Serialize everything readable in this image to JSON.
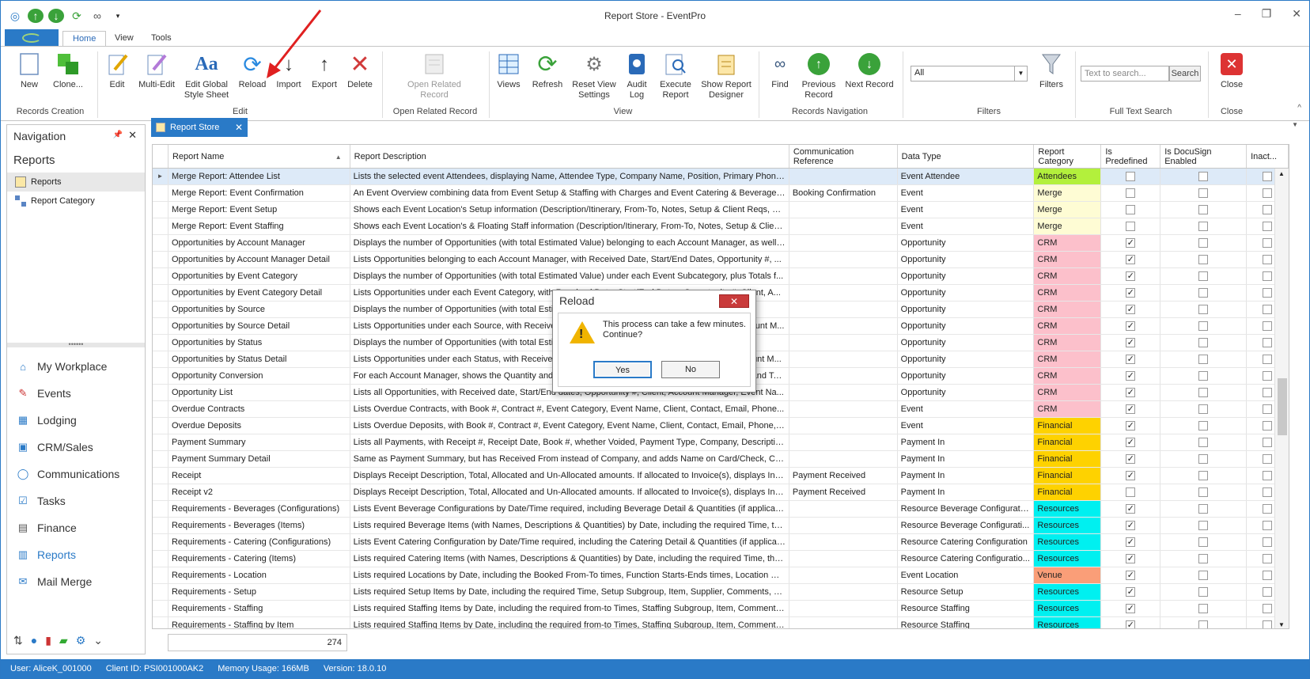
{
  "window": {
    "title": "Report Store - EventPro"
  },
  "menu_tabs": [
    "Home",
    "View",
    "Tools"
  ],
  "ribbon": {
    "buttons": {
      "new": "New",
      "clone": "Clone...",
      "edit": "Edit",
      "multi_edit": "Multi-Edit",
      "edit_global": "Edit Global Style Sheet",
      "reload": "Reload",
      "import": "Import",
      "export": "Export",
      "delete": "Delete",
      "open_related": "Open Related Record",
      "views": "Views",
      "refresh": "Refresh",
      "reset_view": "Reset View Settings",
      "audit_log": "Audit Log",
      "execute_report": "Execute Report",
      "show_designer": "Show Report Designer",
      "find": "Find",
      "previous_record": "Previous Record",
      "next_record": "Next Record",
      "filters": "Filters",
      "close": "Close",
      "search_button": "Search"
    },
    "groups": {
      "records_creation": "Records Creation",
      "edit": "Edit",
      "open_related": "Open Related Record",
      "view": "View",
      "records_navigation": "Records Navigation",
      "filters": "Filters",
      "full_text_search": "Full Text Search",
      "close": "Close"
    },
    "filter_select": "All",
    "search_placeholder": "Text to search..."
  },
  "navigation": {
    "title": "Navigation",
    "section": "Reports",
    "items": [
      "Reports",
      "Report Category"
    ],
    "modules": [
      "My Workplace",
      "Events",
      "Lodging",
      "CRM/Sales",
      "Communications",
      "Tasks",
      "Finance",
      "Reports",
      "Mail Merge"
    ]
  },
  "doc_tab": "Report Store",
  "grid": {
    "headers": [
      "Report Name",
      "Report Description",
      "Communication Reference",
      "Data Type",
      "Report Category",
      "Is Predefined",
      "Is DocuSign Enabled",
      "Inact..."
    ],
    "rows": [
      {
        "name": "Merge Report: Attendee List",
        "desc": "Lists the selected event Attendees, displaying Name, Attendee Type, Company Name, Position, Primary Phone,...",
        "comm": "",
        "type": "Event Attendee",
        "cat": "Attendees",
        "color": "#b3f03c",
        "pre": false
      },
      {
        "name": "Merge Report: Event Confirmation",
        "desc": "An Event Overview combining data from Event Setup & Staffing with Charges and Event Catering & Beverage ...",
        "comm": "Booking Confirmation",
        "type": "Event",
        "cat": "Merge",
        "color": "#fefcd4",
        "pre": false
      },
      {
        "name": "Merge Report: Event Setup",
        "desc": "Shows each Event Location's Setup information (Description/Itinerary, From-To, Notes, Setup & Client Reqs, Q...",
        "comm": "",
        "type": "Event",
        "cat": "Merge",
        "color": "#fefcd4",
        "pre": false
      },
      {
        "name": "Merge Report: Event Staffing",
        "desc": "Shows each Event Location's & Floating Staff information (Description/Itinerary, From-To, Notes, Setup & Client...",
        "comm": "",
        "type": "Event",
        "cat": "Merge",
        "color": "#fefcd4",
        "pre": false
      },
      {
        "name": "Opportunities by Account Manager",
        "desc": "Displays the number of Opportunities (with total Estimated Value) belonging to each Account Manager, as well a...",
        "comm": "",
        "type": "Opportunity",
        "cat": "CRM",
        "color": "#fcc0cb",
        "pre": true
      },
      {
        "name": "Opportunities by Account Manager Detail",
        "desc": "Lists Opportunities belonging to each Account Manager, with Received Date, Start/End Dates, Opportunity #, ...",
        "comm": "",
        "type": "Opportunity",
        "cat": "CRM",
        "color": "#fcc0cb",
        "pre": true
      },
      {
        "name": "Opportunities by Event Category",
        "desc": "Displays the number of Opportunities (with total Estimated Value) under each Event Subcategory, plus Totals f...",
        "comm": "",
        "type": "Opportunity",
        "cat": "CRM",
        "color": "#fcc0cb",
        "pre": true
      },
      {
        "name": "Opportunities by Event Category Detail",
        "desc": "Lists Opportunities under each Event Category, with Received Date, Start/End Dates, Opportunity #, Client, A...",
        "comm": "",
        "type": "Opportunity",
        "cat": "CRM",
        "color": "#fcc0cb",
        "pre": true
      },
      {
        "name": "Opportunities by Source",
        "desc": "Displays the number of Opportunities (with total Estimated Value) under each Source...",
        "comm": "",
        "type": "Opportunity",
        "cat": "CRM",
        "color": "#fcc0cb",
        "pre": true
      },
      {
        "name": "Opportunities by Source Detail",
        "desc": "Lists Opportunities under each Source, with Received Date, Start/End Dates, Opportunity #, Client, Account M...",
        "comm": "",
        "type": "Opportunity",
        "cat": "CRM",
        "color": "#fcc0cb",
        "pre": true
      },
      {
        "name": "Opportunities by Status",
        "desc": "Displays the number of Opportunities (with total Estimated Value) under each Status...",
        "comm": "",
        "type": "Opportunity",
        "cat": "CRM",
        "color": "#fcc0cb",
        "pre": true
      },
      {
        "name": "Opportunities by Status Detail",
        "desc": "Lists Opportunities under each Status, with Received Date, Start/End Dates, Opportunity #, Client, Account M...",
        "comm": "",
        "type": "Opportunity",
        "cat": "CRM",
        "color": "#fcc0cb",
        "pre": true
      },
      {
        "name": "Opportunity Conversion",
        "desc": "For each Account Manager, shows the Quantity and Estimated Value of Opportunities Won, Lost, Open and Total...",
        "comm": "",
        "type": "Opportunity",
        "cat": "CRM",
        "color": "#fcc0cb",
        "pre": true
      },
      {
        "name": "Opportunity List",
        "desc": "Lists all Opportunities, with Received date, Start/End dates, Opportunity #, Client, Account Manager, Event Na...",
        "comm": "",
        "type": "Opportunity",
        "cat": "CRM",
        "color": "#fcc0cb",
        "pre": true
      },
      {
        "name": "Overdue Contracts",
        "desc": "Lists Overdue Contracts, with Book #, Contract #, Event Category, Event Name, Client, Contact, Email, Phone...",
        "comm": "",
        "type": "Event",
        "cat": "CRM",
        "color": "#fcc0cb",
        "pre": true
      },
      {
        "name": "Overdue Deposits",
        "desc": "Lists Overdue Deposits, with Book #, Contract #, Event Category, Event Name, Client, Contact, Email, Phone, ...",
        "comm": "",
        "type": "Event",
        "cat": "Financial",
        "color": "#fed200",
        "pre": true
      },
      {
        "name": "Payment Summary",
        "desc": "Lists all Payments, with Receipt #, Receipt Date, Book #, whether Voided, Payment Type, Company, Descriptio...",
        "comm": "",
        "type": "Payment In",
        "cat": "Financial",
        "color": "#fed200",
        "pre": true
      },
      {
        "name": "Payment Summary Detail",
        "desc": "Same as Payment Summary, but has Received From instead of Company, and adds Name on Card/Check, Card...",
        "comm": "",
        "type": "Payment In",
        "cat": "Financial",
        "color": "#fed200",
        "pre": true
      },
      {
        "name": "Receipt",
        "desc": "Displays Receipt Description, Total, Allocated and Un-Allocated amounts. If allocated to Invoice(s), displays Inv...",
        "comm": "Payment Received",
        "type": "Payment In",
        "cat": "Financial",
        "color": "#fed200",
        "pre": true
      },
      {
        "name": "Receipt v2",
        "desc": "Displays Receipt Description, Total, Allocated and Un-Allocated amounts. If allocated to Invoice(s), displays Inv...",
        "comm": "Payment Received",
        "type": "Payment In",
        "cat": "Financial",
        "color": "#fed200",
        "pre": false
      },
      {
        "name": "Requirements - Beverages (Configurations)",
        "desc": "Lists Event Beverage Configurations by Date/Time required, including Beverage Detail & Quantities (if applicable...",
        "comm": "",
        "type": "Resource Beverage Configuration",
        "cat": "Resources",
        "color": "#00f0f0",
        "pre": true
      },
      {
        "name": "Requirements - Beverages (Items)",
        "desc": "Lists required Beverage Items (with Names, Descriptions & Quantities) by Date, including the required Time, the...",
        "comm": "",
        "type": "Resource Beverage Configurati...",
        "cat": "Resources",
        "color": "#00f0f0",
        "pre": true
      },
      {
        "name": "Requirements - Catering (Configurations)",
        "desc": "Lists Event Catering Configuration by Date/Time required, including the Catering Detail & Quantities (if applicab...",
        "comm": "",
        "type": "Resource Catering Configuration",
        "cat": "Resources",
        "color": "#00f0f0",
        "pre": true
      },
      {
        "name": "Requirements - Catering (Items)",
        "desc": "Lists required Catering Items (with Names, Descriptions & Quantities) by Date, including the required Time, the ...",
        "comm": "",
        "type": "Resource Catering Configuratio...",
        "cat": "Resources",
        "color": "#00f0f0",
        "pre": true
      },
      {
        "name": "Requirements - Location",
        "desc": "Lists required Locations by Date, including the Booked From-To times, Function Starts-Ends times, Location Nam...",
        "comm": "",
        "type": "Event Location",
        "cat": "Venue",
        "color": "#fa9e78",
        "pre": true
      },
      {
        "name": "Requirements - Setup",
        "desc": "Lists required Setup Items by Date, including the required Time, Setup Subgroup, Item, Supplier, Comments, Lo...",
        "comm": "",
        "type": "Resource Setup",
        "cat": "Resources",
        "color": "#00f0f0",
        "pre": true
      },
      {
        "name": "Requirements - Staffing",
        "desc": "Lists required Staffing Items by Date, including the required from-to Times, Staffing Subgroup, Item, Comments...",
        "comm": "",
        "type": "Resource Staffing",
        "cat": "Resources",
        "color": "#00f0f0",
        "pre": true
      },
      {
        "name": "Requirements - Staffing by Item",
        "desc": "Lists required Staffing Items by Date, including the required from-to Times, Staffing Subgroup, Item, Comments...",
        "comm": "",
        "type": "Resource Staffing",
        "cat": "Resources",
        "color": "#00f0f0",
        "pre": true
      }
    ],
    "count": "274"
  },
  "dialog": {
    "title": "Reload",
    "message": "This process can take a few minutes. Continue?",
    "yes": "Yes",
    "no": "No"
  },
  "status": {
    "user": "User: AliceK_001000",
    "client": "Client ID: PSI001000AK2",
    "memory": "Memory Usage: 166MB",
    "version": "Version: 18.0.10"
  },
  "colors": {
    "accent": "#2a7ac7",
    "annotation_arrow": "#e02020"
  }
}
